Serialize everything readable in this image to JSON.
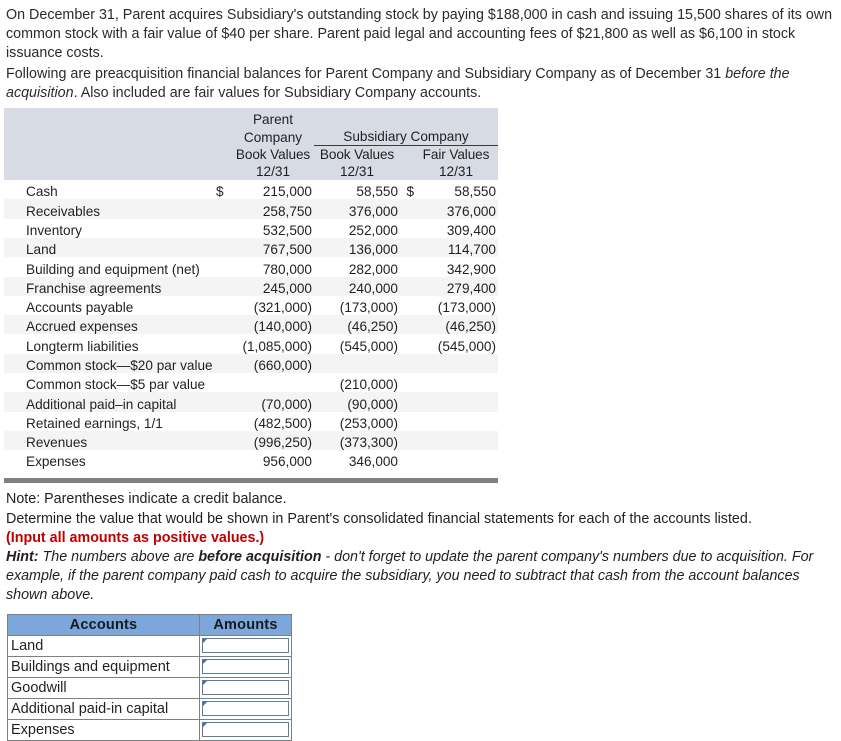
{
  "intro": {
    "para1_a": "On December 31, Parent acquires Subsidiary's outstanding stock by paying $188,000 in cash and issuing 15,500 shares of its own common stock with a fair value of $40 per share. Parent paid legal and accounting fees of $21,800 as well as $6,100 in stock issuance costs.",
    "para2_a": "Following are preacquisition financial balances for Parent Company and Subsidiary Company as of December 31 ",
    "para2_i1": "before the acquisition",
    "para2_b": ". Also included are fair values for Subsidiary Company accounts."
  },
  "balances_table": {
    "header": {
      "parent_line1": "Parent",
      "parent_line2": "Company",
      "subsidiary_span": "Subsidiary Company",
      "parent_book_values": "Book Values",
      "sub_book_values": "Book Values",
      "sub_fair_values": "Fair Values",
      "date_parent": "12/31",
      "date_sub_book": "12/31",
      "date_sub_fair": "12/31"
    },
    "rows": [
      {
        "label": "Cash",
        "dollar": "$",
        "parent": "215,000",
        "dollar2": "",
        "sub_book": "58,550",
        "dollar3": "$",
        "sub_fair": "58,550"
      },
      {
        "label": "Receivables",
        "dollar": "",
        "parent": "258,750",
        "dollar2": "",
        "sub_book": "376,000",
        "dollar3": "",
        "sub_fair": "376,000"
      },
      {
        "label": "Inventory",
        "dollar": "",
        "parent": "532,500",
        "dollar2": "",
        "sub_book": "252,000",
        "dollar3": "",
        "sub_fair": "309,400"
      },
      {
        "label": "Land",
        "dollar": "",
        "parent": "767,500",
        "dollar2": "",
        "sub_book": "136,000",
        "dollar3": "",
        "sub_fair": "114,700"
      },
      {
        "label": "Building and equipment (net)",
        "dollar": "",
        "parent": "780,000",
        "dollar2": "",
        "sub_book": "282,000",
        "dollar3": "",
        "sub_fair": "342,900"
      },
      {
        "label": "Franchise agreements",
        "dollar": "",
        "parent": "245,000",
        "dollar2": "",
        "sub_book": "240,000",
        "dollar3": "",
        "sub_fair": "279,400"
      },
      {
        "label": "Accounts payable",
        "dollar": "",
        "parent": "(321,000)",
        "dollar2": "",
        "sub_book": "(173,000)",
        "dollar3": "",
        "sub_fair": "(173,000)"
      },
      {
        "label": "Accrued expenses",
        "dollar": "",
        "parent": "(140,000)",
        "dollar2": "",
        "sub_book": "(46,250)",
        "dollar3": "",
        "sub_fair": "(46,250)"
      },
      {
        "label": "Longterm liabilities",
        "dollar": "",
        "parent": "(1,085,000)",
        "dollar2": "",
        "sub_book": "(545,000)",
        "dollar3": "",
        "sub_fair": "(545,000)"
      },
      {
        "label": "Common stock—$20 par value",
        "dollar": "",
        "parent": "(660,000)",
        "dollar2": "",
        "sub_book": "",
        "dollar3": "",
        "sub_fair": ""
      },
      {
        "label": "Common stock—$5 par value",
        "dollar": "",
        "parent": "",
        "dollar2": "",
        "sub_book": "(210,000)",
        "dollar3": "",
        "sub_fair": ""
      },
      {
        "label": "Additional paid–in capital",
        "dollar": "",
        "parent": "(70,000)",
        "dollar2": "",
        "sub_book": "(90,000)",
        "dollar3": "",
        "sub_fair": ""
      },
      {
        "label": "Retained earnings, 1/1",
        "dollar": "",
        "parent": "(482,500)",
        "dollar2": "",
        "sub_book": "(253,000)",
        "dollar3": "",
        "sub_fair": ""
      },
      {
        "label": "Revenues",
        "dollar": "",
        "parent": "(996,250)",
        "dollar2": "",
        "sub_book": "(373,300)",
        "dollar3": "",
        "sub_fair": ""
      },
      {
        "label": "Expenses",
        "dollar": "",
        "parent": "956,000",
        "dollar2": "",
        "sub_book": "346,000",
        "dollar3": "",
        "sub_fair": ""
      }
    ]
  },
  "notes": {
    "note": "Note: Parentheses indicate a credit balance.",
    "determine": "Determine the value that would be shown in Parent's consolidated financial statements for each of the accounts listed.",
    "input_instruction": "(Input all amounts as positive values.)",
    "hint_label": "Hint:",
    "hint_a": " The numbers above are ",
    "hint_bold": "before acquisition",
    "hint_b": " - don't forget to update the parent company's numbers due to acquisition. For example, if the parent company paid cash to acquire the subsidiary, you need to subtract that cash from the account balances shown above."
  },
  "answer_table": {
    "columns": [
      "Accounts",
      "Amounts"
    ],
    "rows": [
      {
        "account": "Land",
        "amount": ""
      },
      {
        "account": "Buildings and equipment",
        "amount": ""
      },
      {
        "account": "Goodwill",
        "amount": ""
      },
      {
        "account": "Additional paid-in capital",
        "amount": ""
      },
      {
        "account": "Expenses",
        "amount": ""
      }
    ]
  },
  "colors": {
    "header_band": "#d7dbe4",
    "answer_header": "#7ba7dd",
    "rule": "#808080",
    "red_text": "#c00000",
    "input_border": "#5a7d9e"
  }
}
